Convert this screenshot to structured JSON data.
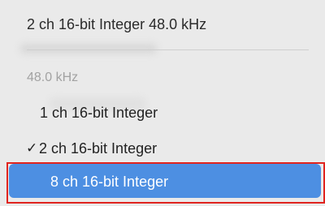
{
  "menu": {
    "header": "2 ch 16-bit Integer 48.0 kHz",
    "section_label": "48.0 kHz",
    "items": [
      {
        "label": "1 ch 16-bit Integer",
        "checked": false,
        "selected": false
      },
      {
        "label": "2 ch 16-bit Integer",
        "checked": true,
        "check_glyph": "✓",
        "selected": false
      },
      {
        "label": "8 ch 16-bit Integer",
        "checked": false,
        "selected": true
      }
    ]
  },
  "colors": {
    "selection": "#4d8fe2",
    "highlight_outline": "#e0241f",
    "section_label": "#a2a2a2"
  }
}
